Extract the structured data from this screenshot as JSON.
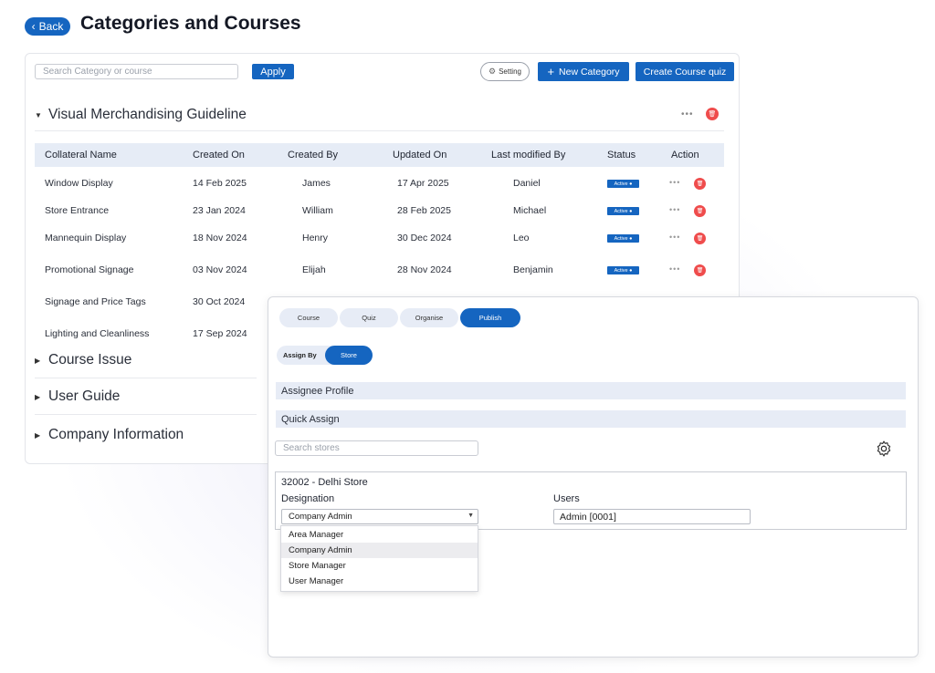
{
  "header": {
    "back_label": "Back",
    "title": "Categories and Courses"
  },
  "toolbar": {
    "search_placeholder": "Search Category or course",
    "apply_label": "Apply",
    "setting_label": "Setting",
    "new_category_label": "New Category",
    "create_quiz_label": "Create Course quiz"
  },
  "sections": [
    {
      "label": "Visual Merchandising Guideline",
      "expanded": true
    },
    {
      "label": "Course Issue",
      "expanded": false
    },
    {
      "label": "User Guide",
      "expanded": false
    },
    {
      "label": "Company Information",
      "expanded": false
    }
  ],
  "table": {
    "columns": [
      "Collateral Name",
      "Created On",
      "Created By",
      "Updated On",
      "Last modified By",
      "Status",
      "Action"
    ],
    "rows": [
      {
        "name": "Window Display",
        "created_on": "14 Feb 2025",
        "created_by": "James",
        "updated_on": "17 Apr 2025",
        "modified_by": "Daniel",
        "status": "Active ●"
      },
      {
        "name": "Store Entrance",
        "created_on": "23 Jan 2024",
        "created_by": "William",
        "updated_on": "28 Feb 2025",
        "modified_by": "Michael",
        "status": "Active ●"
      },
      {
        "name": "Mannequin Display",
        "created_on": "18 Nov 2024",
        "created_by": "Henry",
        "updated_on": "30 Dec 2024",
        "modified_by": "Leo",
        "status": "Active ●"
      },
      {
        "name": "Promotional Signage",
        "created_on": "03 Nov 2024",
        "created_by": "Elijah",
        "updated_on": "28 Nov 2024",
        "modified_by": "Benjamin",
        "status": "Active ●"
      },
      {
        "name": "Signage and Price Tags",
        "created_on": "30 Oct 2024"
      },
      {
        "name": "Lighting and Cleanliness",
        "created_on": "17 Sep 2024"
      }
    ]
  },
  "panel": {
    "tabs": [
      "Course",
      "Quiz",
      "Organise",
      "Publish"
    ],
    "active_tab": "Publish",
    "assign_by_label": "Assign By",
    "assign_by_value": "Store",
    "assignee_profile_label": "Assignee Profile",
    "quick_assign_label": "Quick Assign",
    "store_search_placeholder": "Search stores",
    "store_name": "32002 - Delhi Store",
    "designation_label": "Designation",
    "designation_value": "Company Admin",
    "users_label": "Users",
    "users_value": "Admin [0001]",
    "designation_options": [
      "Area Manager",
      "Company Admin",
      "Store Manager",
      "User Manager"
    ],
    "selected_option": "Company Admin"
  },
  "colors": {
    "accent": "#1565c0",
    "danger": "#ef4c4c",
    "header_bg": "#e6ecf6"
  }
}
